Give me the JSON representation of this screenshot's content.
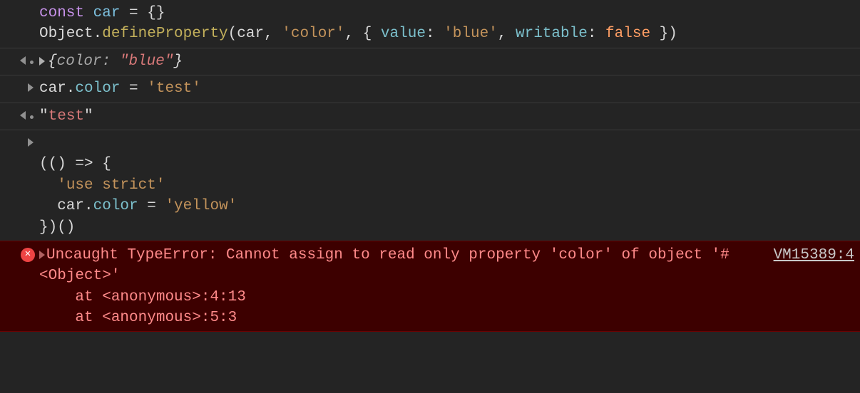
{
  "entries": {
    "input1": {
      "line1": {
        "kw": "const",
        "var": " car",
        "rest": " = {}"
      },
      "line2": {
        "p1": "Object.",
        "fn": "defineProperty",
        "p2": "(car, ",
        "s1": "'color'",
        "p3": ", { ",
        "k1": "value",
        "p4": ": ",
        "s2": "'blue'",
        "p5": ", ",
        "k2": "writable",
        "p6": ": ",
        "b1": "false",
        "p7": " })"
      }
    },
    "output1": {
      "open": "{",
      "pname": "color:",
      "pval": " \"blue\"",
      "close": "}"
    },
    "input2": {
      "p1": "car.",
      "prop": "color",
      "p2": " = ",
      "s1": "'test'"
    },
    "output2": {
      "q1": "\"",
      "val": "test",
      "q2": "\""
    },
    "input3": {
      "l1": "(() => {",
      "l2a": "  ",
      "l2b": "'use strict'",
      "l3a": "  car.",
      "l3b": "color",
      "l3c": " = ",
      "l3d": "'yellow'",
      "l4": "})()"
    },
    "error": {
      "message": "Uncaught TypeError: Cannot assign to read only property 'color' of object '#<Object>'",
      "stack1": "    at <anonymous>:4:13",
      "stack2": "    at <anonymous>:5:3",
      "source": "VM15389:4"
    }
  }
}
